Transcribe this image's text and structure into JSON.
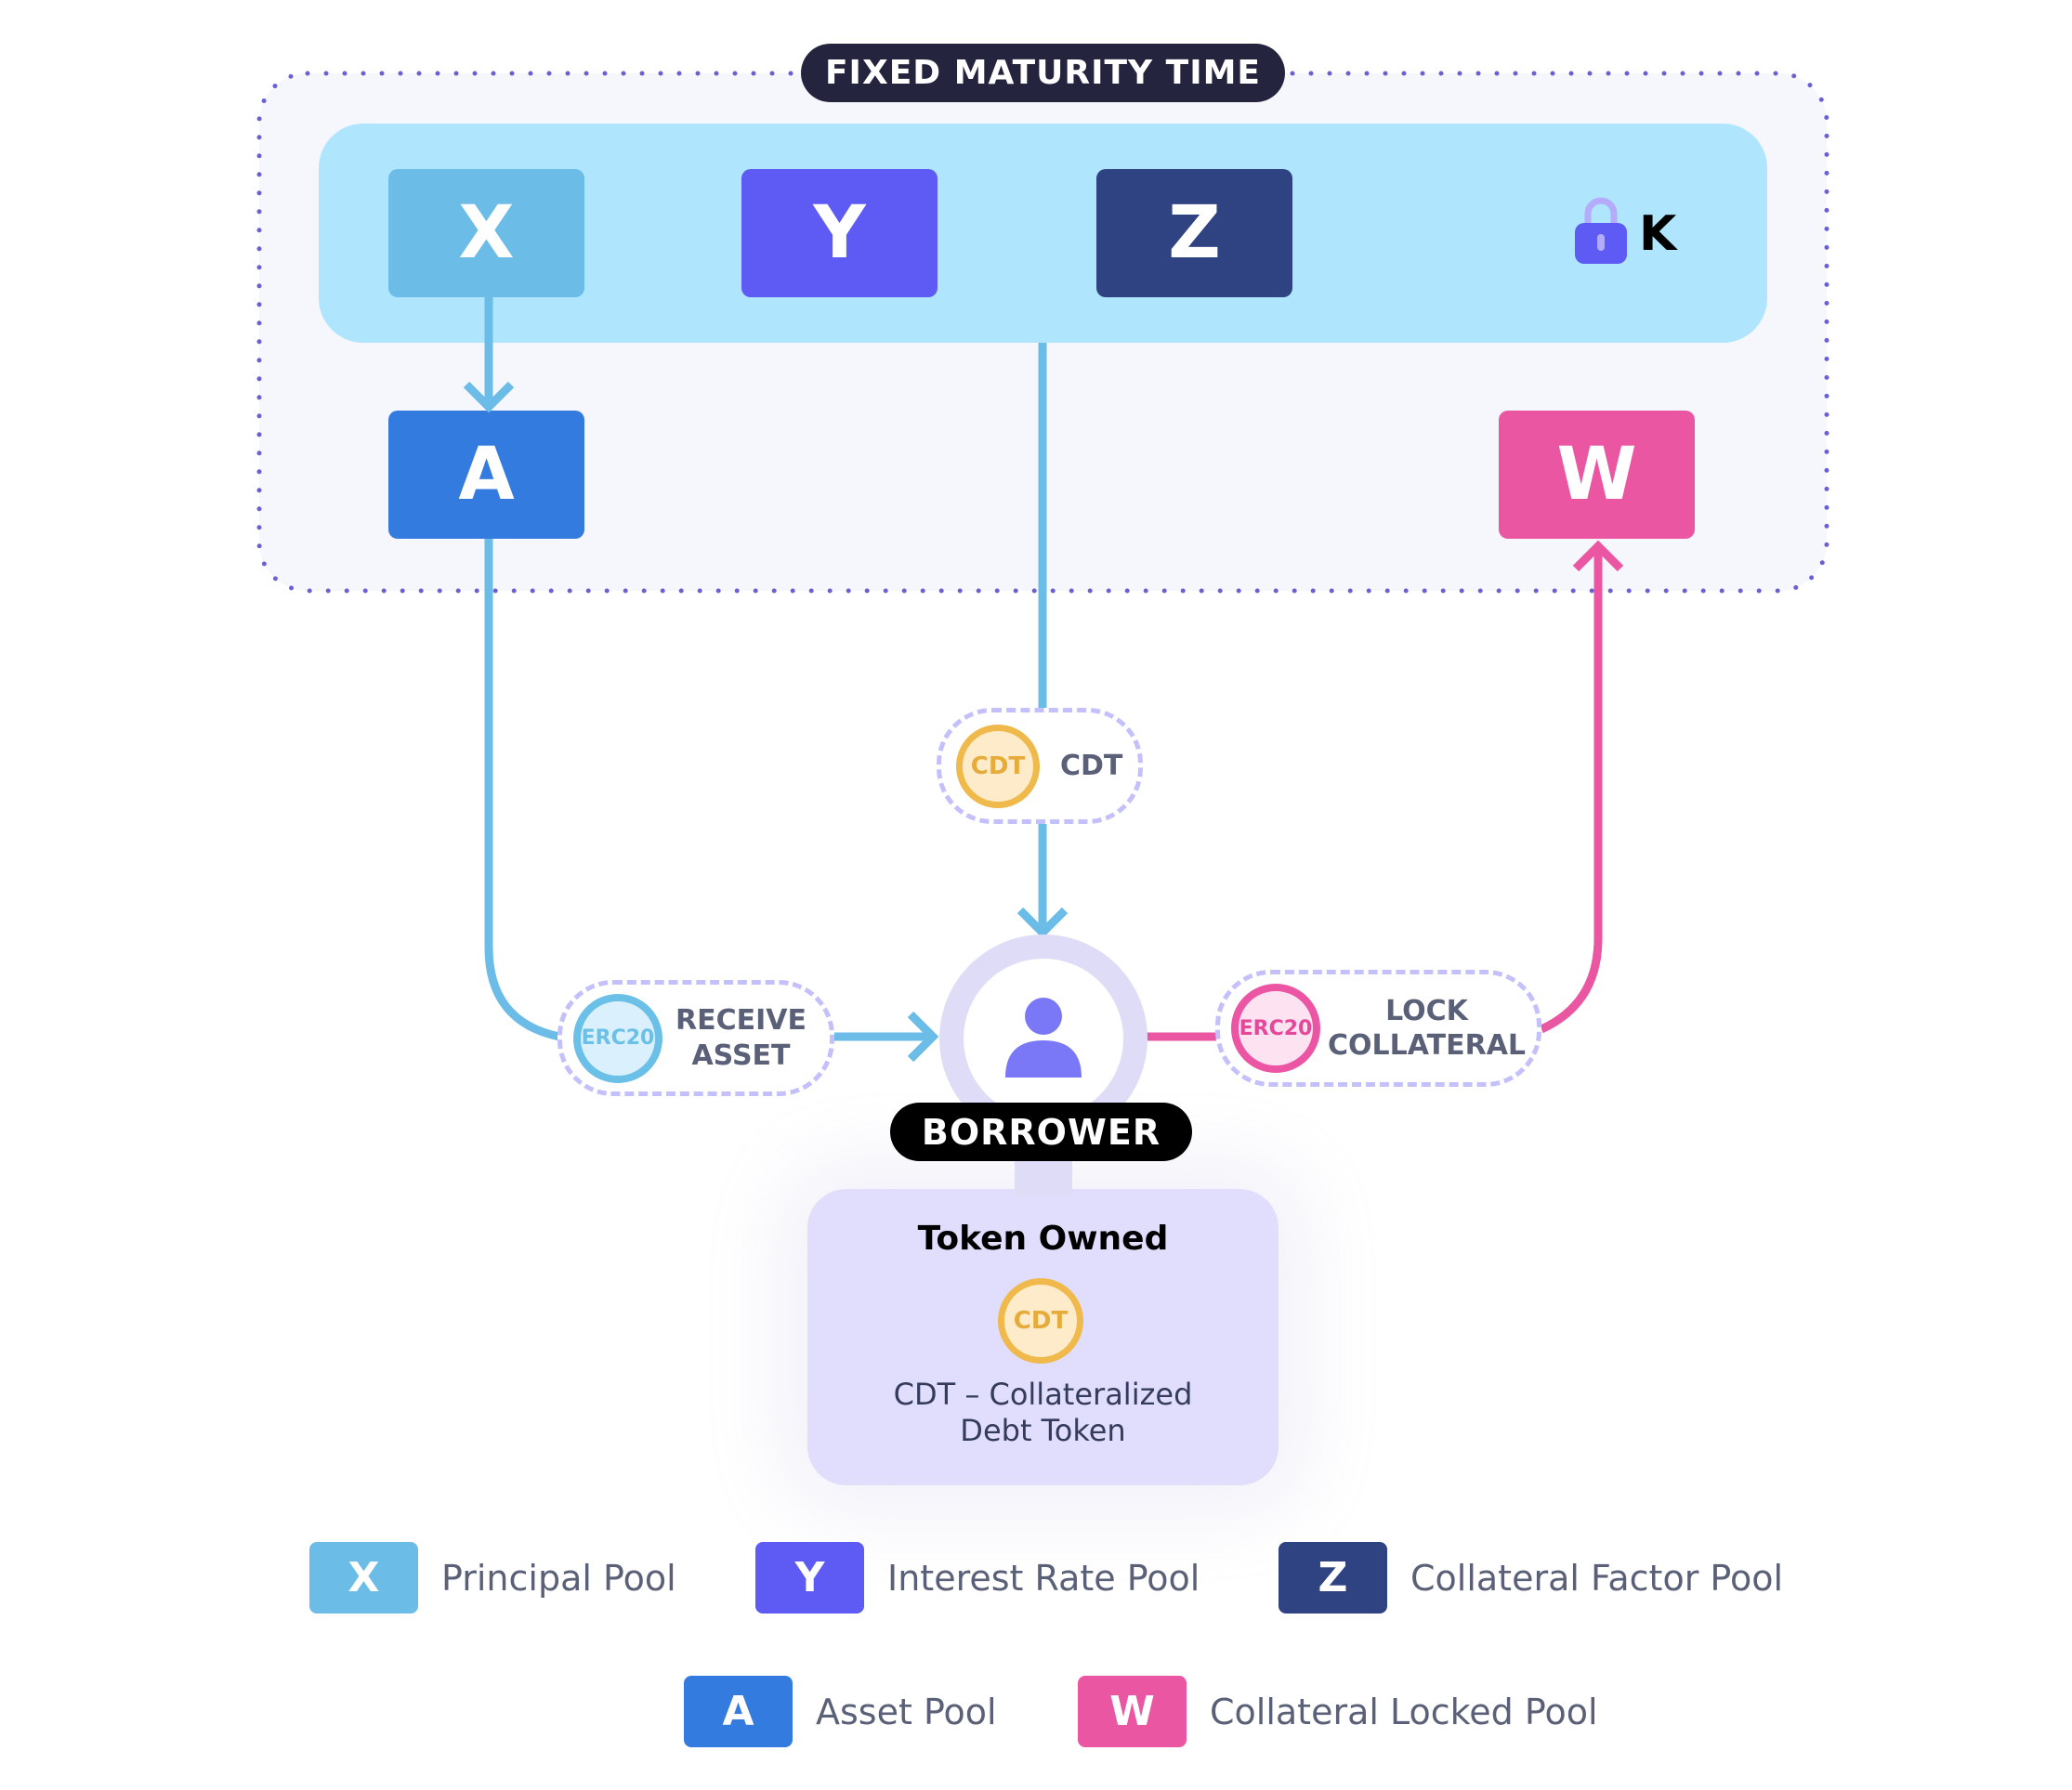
{
  "header": {
    "title": "FIXED MATURITY TIME"
  },
  "colors": {
    "x": "#6bbde8",
    "y": "#5e5af4",
    "z": "#2f4282",
    "a": "#347bdf",
    "w": "#eb56a3",
    "blue_line": "#6bbde8",
    "pink_line": "#eb56a3",
    "dots": "#6b5fd6"
  },
  "pools": {
    "x": "X",
    "y": "Y",
    "z": "Z",
    "a": "A",
    "w": "W"
  },
  "lock": {
    "icon": "lock-icon",
    "label": "K"
  },
  "cdt_tag": {
    "coin": "CDT",
    "label": "CDT"
  },
  "receive_tag": {
    "coin": "ERC20",
    "line1": "RECEIVE",
    "line2": "ASSET"
  },
  "lock_tag": {
    "coin": "ERC20",
    "line1": "LOCK",
    "line2": "COLLATERAL"
  },
  "borrower": {
    "icon": "user-icon",
    "label": "BORROWER"
  },
  "token_owned": {
    "title": "Token Owned",
    "coin": "CDT",
    "desc_line1": "CDT – Collateralized",
    "desc_line2": "Debt Token"
  },
  "legend": [
    {
      "key": "X",
      "label": "Principal Pool"
    },
    {
      "key": "Y",
      "label": "Interest Rate Pool"
    },
    {
      "key": "Z",
      "label": "Collateral Factor Pool"
    },
    {
      "key": "A",
      "label": "Asset Pool"
    },
    {
      "key": "W",
      "label": "Collateral Locked Pool"
    }
  ]
}
